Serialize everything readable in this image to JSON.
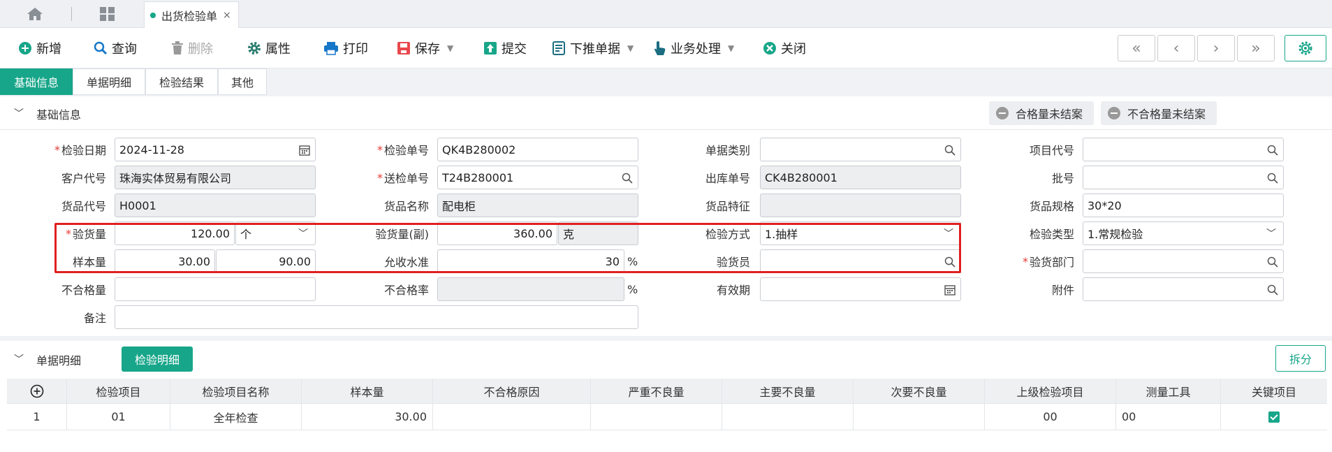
{
  "tabbar": {
    "active_tab": "出货检验单",
    "close_glyph": "×"
  },
  "toolbar": {
    "new": "新增",
    "query": "查询",
    "delete": "删除",
    "properties": "属性",
    "print": "打印",
    "save": "保存",
    "submit": "提交",
    "push_down": "下推单据",
    "business": "业务处理",
    "close": "关闭",
    "nav_first": "«",
    "nav_prev": "‹",
    "nav_next": "›",
    "nav_last": "»"
  },
  "subtabs": [
    "基础信息",
    "单据明细",
    "检验结果",
    "其他"
  ],
  "section": {
    "title": "基础信息",
    "status_open": "合格量未结案",
    "status_reject": "不合格量未结案"
  },
  "form": {
    "inspect_date": {
      "label": "检验日期",
      "value": "2024-11-28"
    },
    "inspect_no": {
      "label": "检验单号",
      "value": "QK4B280002"
    },
    "doc_type": {
      "label": "单据类别",
      "value": ""
    },
    "project_code": {
      "label": "项目代号",
      "value": ""
    },
    "customer_code": {
      "label": "客户代号",
      "value": "珠海实体贸易有限公司"
    },
    "submit_no": {
      "label": "送检单号",
      "value": "T24B280001"
    },
    "outbound_no": {
      "label": "出库单号",
      "value": "CK4B280001"
    },
    "batch_no": {
      "label": "批号",
      "value": ""
    },
    "item_code": {
      "label": "货品代号",
      "value": "H0001"
    },
    "item_name": {
      "label": "货品名称",
      "value": "配电柜"
    },
    "item_feature": {
      "label": "货品特征",
      "value": ""
    },
    "item_spec": {
      "label": "货品规格",
      "value": "30*20"
    },
    "inspect_qty": {
      "label": "验货量",
      "value": "120.00",
      "unit": "个"
    },
    "inspect_qty_sub": {
      "label": "验货量(副)",
      "value": "360.00",
      "unit": "克"
    },
    "inspect_method": {
      "label": "检验方式",
      "value": "1.抽样"
    },
    "inspect_type": {
      "label": "检验类型",
      "value": "1.常规检验"
    },
    "sample_qty": {
      "label": "样本量",
      "value1": "30.00",
      "value2": "90.00"
    },
    "accept_level": {
      "label": "允收水准",
      "value": "30",
      "unit": "%"
    },
    "inspector": {
      "label": "验货员",
      "value": ""
    },
    "inspect_dept": {
      "label": "验货部门",
      "value": ""
    },
    "reject_qty": {
      "label": "不合格量",
      "value": ""
    },
    "reject_rate": {
      "label": "不合格率",
      "value": "",
      "unit": "%"
    },
    "valid_period": {
      "label": "有效期",
      "value": ""
    },
    "attachment": {
      "label": "附件",
      "value": ""
    },
    "remark": {
      "label": "备注",
      "value": ""
    }
  },
  "detail": {
    "title": "单据明细",
    "tab": "检验明细",
    "split": "拆分",
    "columns": [
      "检验项目",
      "检验项目名称",
      "样本量",
      "不合格原因",
      "严重不良量",
      "主要不良量",
      "次要不良量",
      "上级检验项目",
      "测量工具",
      "关键项目"
    ],
    "rows": [
      {
        "no": "1",
        "item": "01",
        "name": "全年检查",
        "sample": "30.00",
        "reason": "",
        "severe": "",
        "major": "",
        "minor": "",
        "parent": "00",
        "tool": "00",
        "key": true
      }
    ]
  },
  "colors": {
    "accent": "#17a689",
    "required": "#e53935",
    "highlight": "#e02020"
  }
}
